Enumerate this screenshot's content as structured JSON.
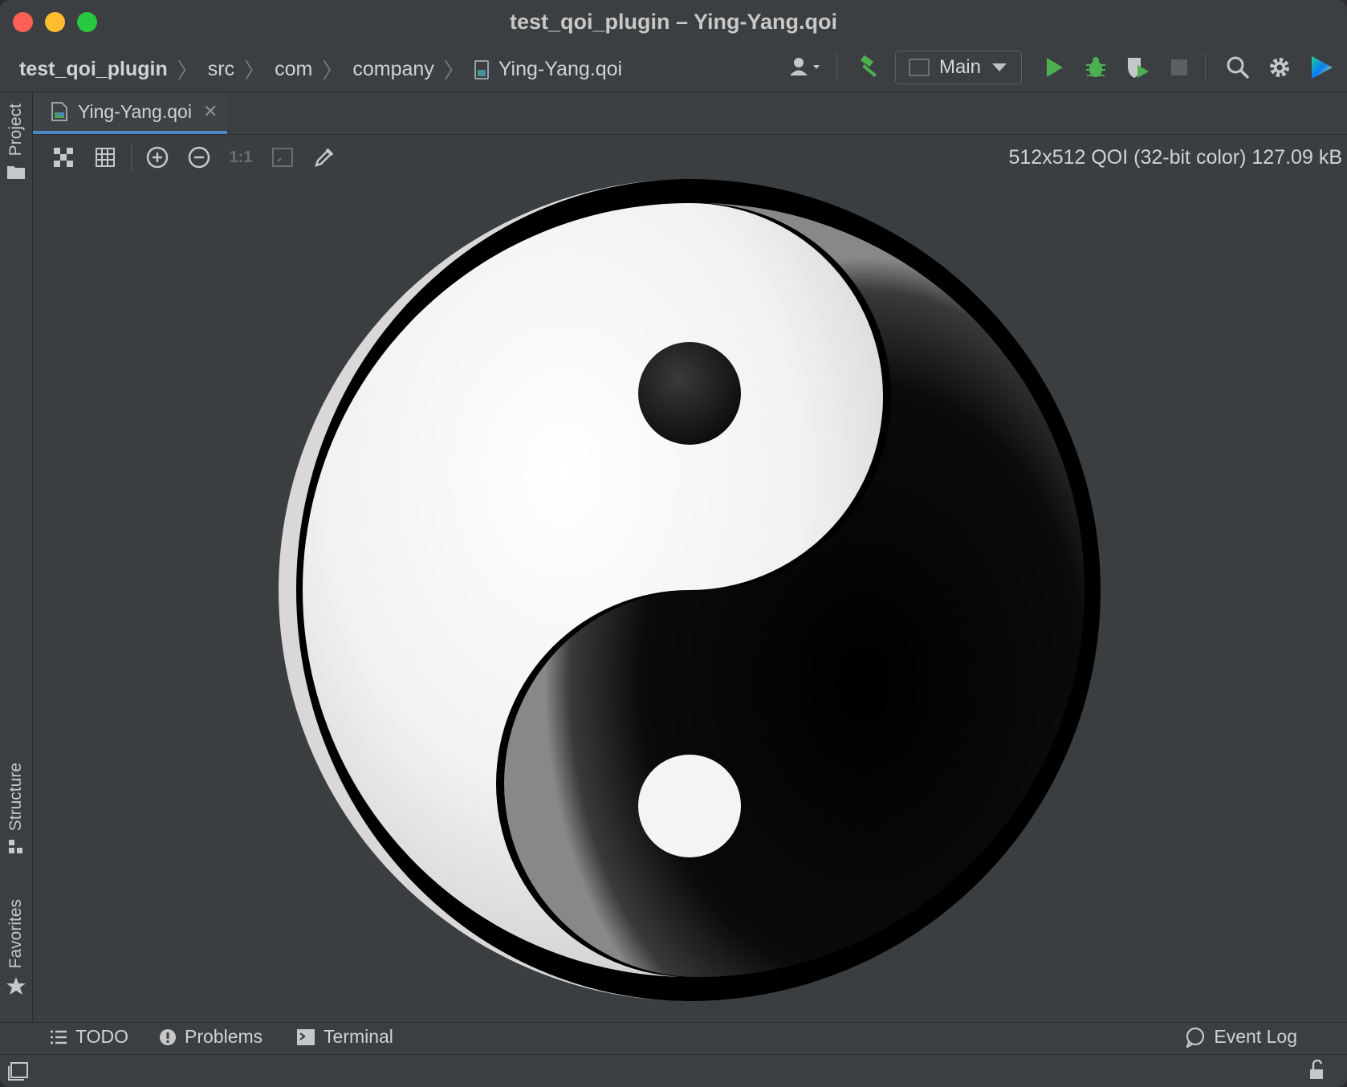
{
  "window": {
    "title": "test_qoi_plugin – Ying-Yang.qoi"
  },
  "breadcrumbs": {
    "items": [
      "test_qoi_plugin",
      "src",
      "com",
      "company",
      "Ying-Yang.qoi"
    ]
  },
  "run_config": {
    "label": "Main"
  },
  "tabs": [
    {
      "label": "Ying-Yang.qoi",
      "active": true
    }
  ],
  "image_info": {
    "text": "512x512 QOI (32-bit color) 127.09 kB"
  },
  "image_toolbar": {
    "actual_size_label": "1:1"
  },
  "side_tabs": {
    "project": "Project",
    "structure": "Structure",
    "favorites": "Favorites"
  },
  "bottom_tools": {
    "todo": "TODO",
    "problems": "Problems",
    "terminal": "Terminal",
    "event_log": "Event Log"
  },
  "colors": {
    "accent": "#4a88c7",
    "run_green": "#4caf50",
    "background": "#3c3f41"
  }
}
